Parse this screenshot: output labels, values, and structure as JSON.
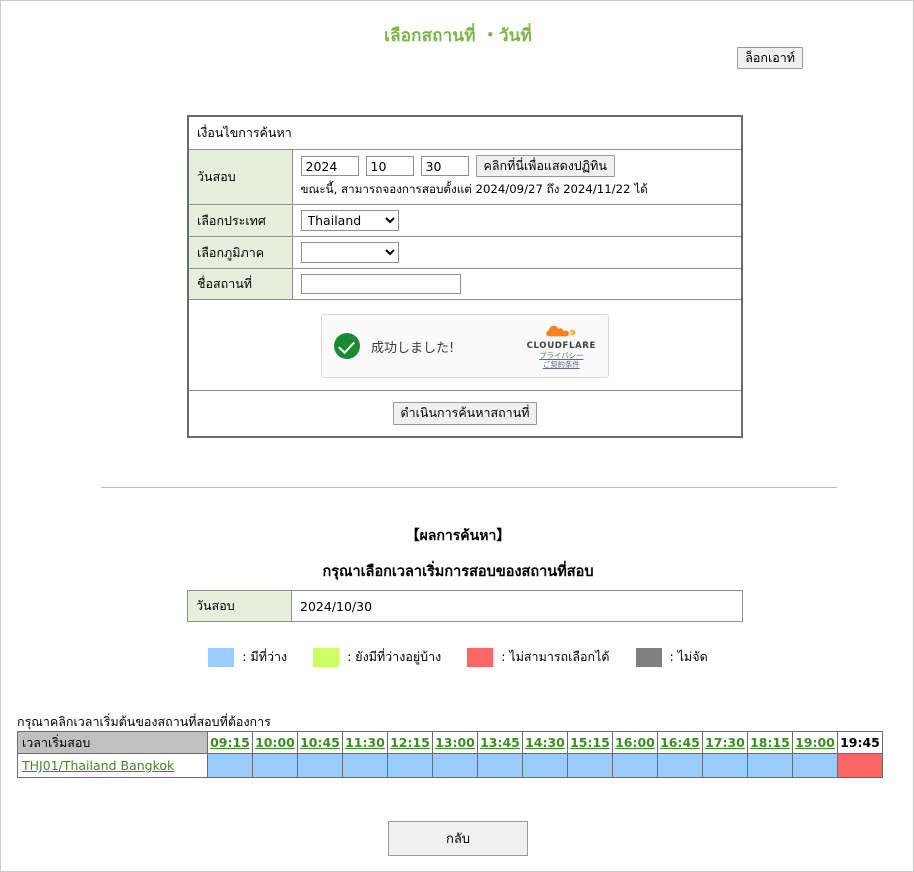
{
  "header": {
    "title": "เลือกสถานที่ ・วันที่",
    "title_color": "#7ab648",
    "logout_label": "ล็อกเอาท์"
  },
  "criteria": {
    "section_label": "เงื่อนไขการค้นหา",
    "exam_date_label": "วันสอบ",
    "year": "2024",
    "month": "10",
    "day": "30",
    "calendar_button": "คลิกที่นี่เพื่อแสดงปฏิทิน",
    "range_note": "ขณะนี้, สามารถจองการสอบตั้งแต่ 2024/09/27 ถึง 2024/11/22 ได้",
    "country_label": "เลือกประเทศ",
    "country_value": "Thailand",
    "country_options": [
      "Thailand"
    ],
    "region_label": "เลือกภูมิภาค",
    "region_value": "",
    "region_options": [
      ""
    ],
    "venue_name_label": "ชื่อสถานที่",
    "venue_name_value": "",
    "venue_name_placeholder": "",
    "search_button": "ดำเนินการค้นหาสถานที่"
  },
  "captcha": {
    "status_text": "成功しました!",
    "brand": "CLOUDFLARE",
    "privacy_link": "プライバシー",
    "terms_link": "ご契約条件"
  },
  "results": {
    "heading": "【ผลการค้นหา】",
    "subheading": "กรุณาเลือกเวลาเริ่มการสอบของสถานที่สอบ",
    "exam_date_label": "วันสอบ",
    "exam_date_value": "2024/10/30"
  },
  "legend": [
    {
      "color": "#99ccff",
      "label": ": มีที่ว่าง"
    },
    {
      "color": "#ccff66",
      "label": ": ยังมีที่ว่างอยู่บ้าง"
    },
    {
      "color": "#ff6666",
      "label": ": ไม่สามารถเลือกได้"
    },
    {
      "color": "#808080",
      "label": ": ไม่จัด"
    }
  ],
  "slots": {
    "hint": "กรุณาคลิกเวลาเริ่มต้นของสถานที่สอบที่ต้องการ",
    "corner_label": "เวลาเริ่มสอบ",
    "times": [
      {
        "label": "09:15",
        "link": true
      },
      {
        "label": "10:00",
        "link": true
      },
      {
        "label": "10:45",
        "link": true
      },
      {
        "label": "11:30",
        "link": true
      },
      {
        "label": "12:15",
        "link": true
      },
      {
        "label": "13:00",
        "link": true
      },
      {
        "label": "13:45",
        "link": true
      },
      {
        "label": "14:30",
        "link": true
      },
      {
        "label": "15:15",
        "link": true
      },
      {
        "label": "16:00",
        "link": true
      },
      {
        "label": "16:45",
        "link": true
      },
      {
        "label": "17:30",
        "link": true
      },
      {
        "label": "18:15",
        "link": true
      },
      {
        "label": "19:00",
        "link": true
      },
      {
        "label": "19:45",
        "link": false
      }
    ],
    "rows": [
      {
        "venue": "THJ01/Thailand Bangkok",
        "cells": [
          "#99ccff",
          "#99ccff",
          "#99ccff",
          "#99ccff",
          "#99ccff",
          "#99ccff",
          "#99ccff",
          "#99ccff",
          "#99ccff",
          "#99ccff",
          "#99ccff",
          "#99ccff",
          "#99ccff",
          "#99ccff",
          "#ff6666"
        ]
      }
    ]
  },
  "footer": {
    "back_button": "กลับ"
  }
}
